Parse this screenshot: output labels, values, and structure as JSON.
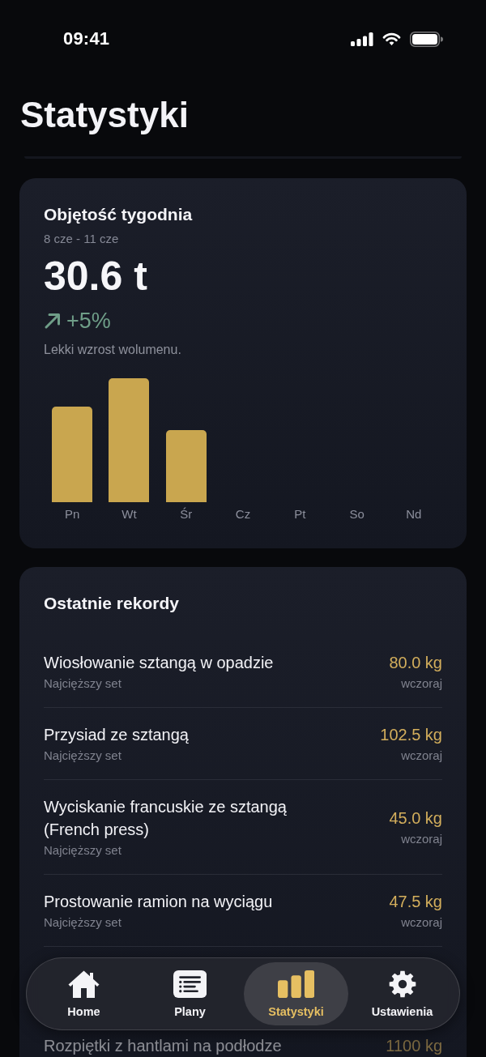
{
  "status_bar": {
    "time": "09:41"
  },
  "header": {
    "title": "Statystyki"
  },
  "weekly_volume": {
    "title": "Objętość tygodnia",
    "date_range": "8 cze - 11 cze",
    "total": "30.6 t",
    "rising": true,
    "change": "+5%",
    "note": "Lekki wzrost wolumenu.",
    "days": [
      {
        "label": "Pn"
      },
      {
        "label": "Wt"
      },
      {
        "label": "Śr"
      },
      {
        "label": "Cz"
      },
      {
        "label": "Pt"
      },
      {
        "label": "So"
      },
      {
        "label": "Nd"
      }
    ]
  },
  "records": {
    "title": "Ostatnie rekordy",
    "rows": [
      {
        "exercise": "Wiosłowanie sztangą w opadzie",
        "detail": "Najcięższy set",
        "value": "80.0 kg",
        "when": "wczoraj"
      },
      {
        "exercise": "Przysiad ze sztangą",
        "detail": "Najcięższy set",
        "value": "102.5 kg",
        "when": "wczoraj"
      },
      {
        "exercise": "Wyciskanie francuskie ze sztangą (French press)",
        "detail": "Najcięższy set",
        "value": "45.0 kg",
        "when": "wczoraj"
      },
      {
        "exercise": "Prostowanie ramion na wyciągu",
        "detail": "Najcięższy set",
        "value": "47.5 kg",
        "when": "wczoraj"
      }
    ],
    "faded_row": {
      "exercise": "Rozpiętki z hantlami na podłodze",
      "value": "1100 kg"
    }
  },
  "tab_bar": {
    "tabs": [
      {
        "label": "Home",
        "selected": false
      },
      {
        "label": "Plany",
        "selected": false
      },
      {
        "label": "Statystyki",
        "selected": true
      },
      {
        "label": "Ustawienia",
        "selected": false
      }
    ]
  }
}
